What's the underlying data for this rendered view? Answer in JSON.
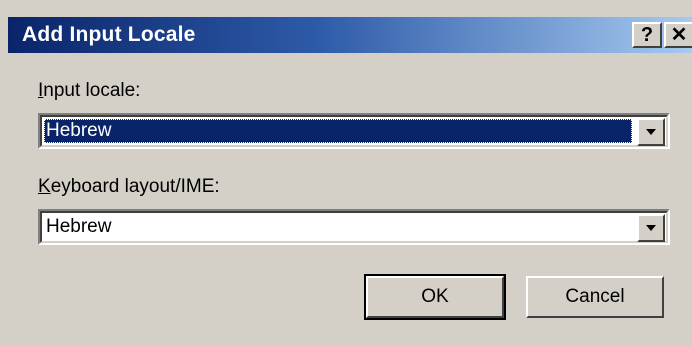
{
  "window": {
    "title": "Add Input Locale",
    "help_label": "?",
    "close_label": "✕"
  },
  "input_locale": {
    "label_first": "I",
    "label_rest": "nput locale:",
    "value": "Hebrew"
  },
  "keyboard_layout": {
    "label_first": "K",
    "label_rest": "eyboard layout/IME:",
    "value": "Hebrew"
  },
  "buttons": {
    "ok": "OK",
    "cancel": "Cancel"
  },
  "icons": {
    "help": "question-mark-icon",
    "close": "close-icon",
    "dropdown": "chevron-down-icon"
  },
  "colors": {
    "title_start": "#0a246a",
    "title_end": "#a6caf0",
    "face": "#d4d0c8",
    "selection": "#0a246a"
  }
}
